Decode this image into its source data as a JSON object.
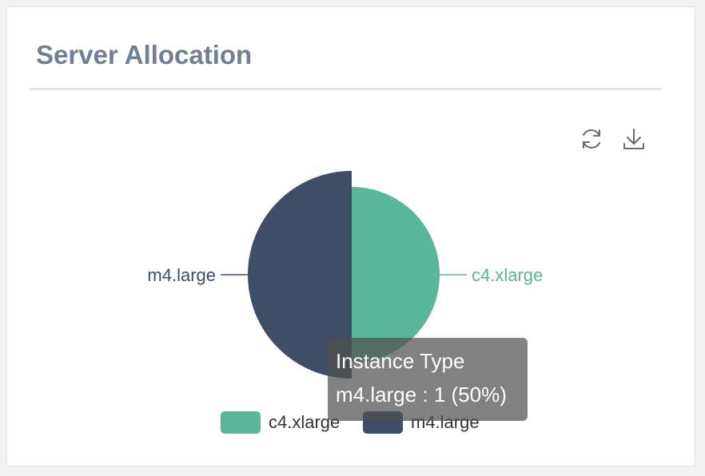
{
  "card": {
    "title": "Server Allocation"
  },
  "toolbar": {
    "refresh_icon": "refresh-icon",
    "download_icon": "download-icon"
  },
  "colors": {
    "c4_xlarge": "#5ab69a",
    "m4_large": "#3d4e66",
    "title": "#6e7f96"
  },
  "tooltip": {
    "title": "Instance Type",
    "body": "m4.large : 1 (50%)"
  },
  "chart_data": {
    "type": "pie",
    "title": "",
    "categories": [
      "c4.xlarge",
      "m4.large"
    ],
    "values": [
      1,
      1
    ],
    "percent": [
      50,
      50
    ],
    "highlighted": "m4.large",
    "legend": {
      "placement": "bottom",
      "entries": [
        "c4.xlarge",
        "m4.large"
      ]
    },
    "series_colors": [
      "#5ab69a",
      "#3d4e66"
    ]
  }
}
